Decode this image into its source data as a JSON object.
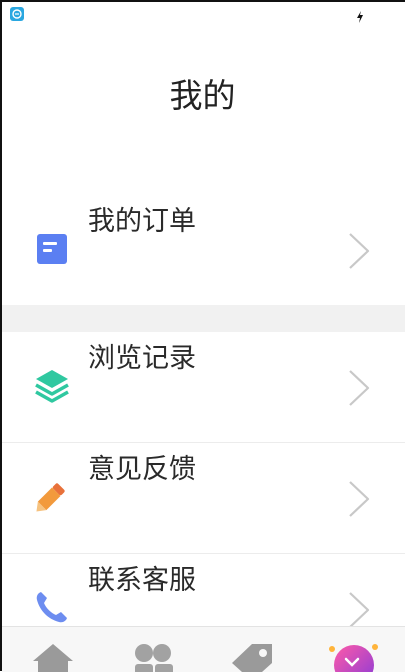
{
  "page": {
    "title": "我的"
  },
  "menu": [
    {
      "label": "我的订单",
      "icon": "order-list-icon",
      "color": "#5b7ff2"
    },
    {
      "label": "浏览记录",
      "icon": "layers-icon",
      "color": "#2fc8a0"
    },
    {
      "label": "意见反馈",
      "icon": "pencil-icon",
      "color": "#f29a3c"
    },
    {
      "label": "联系客服",
      "icon": "phone-icon",
      "color": "#6d8df0"
    }
  ],
  "tabbar": {
    "tabs": [
      {
        "name": "home",
        "icon": "home-icon"
      },
      {
        "name": "category",
        "icon": "category-icon"
      },
      {
        "name": "tag",
        "icon": "tag-icon"
      },
      {
        "name": "mine",
        "icon": "mine-avatar-icon",
        "active": true
      }
    ]
  },
  "colors": {
    "background": "#ffffff",
    "section_gap": "#f1f1f1",
    "text": "#2a2a2a",
    "chevron": "#c8c8c8",
    "tab_icon": "#9a9a9a"
  }
}
